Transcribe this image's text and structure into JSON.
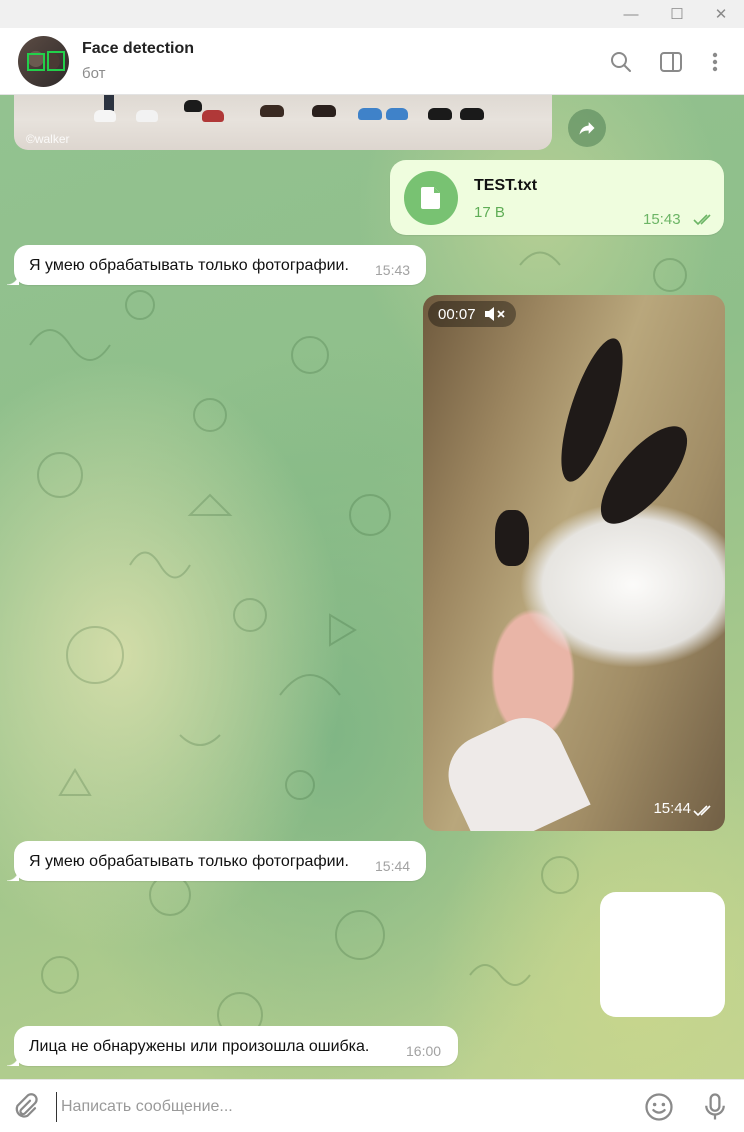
{
  "window": {
    "minimize": "—",
    "maximize": "☐",
    "close": "✕"
  },
  "header": {
    "title": "Face detection",
    "subtitle": "бот"
  },
  "messages": {
    "photo_watermark": "©walker",
    "file": {
      "name": "TEST.txt",
      "size": "17 B",
      "time": "15:43"
    },
    "in1": {
      "text": "Я умею обрабатывать только фотографии.",
      "time": "15:43"
    },
    "video": {
      "duration": "00:07",
      "time": "15:44"
    },
    "in2": {
      "text": "Я умею обрабатывать только фотографии.",
      "time": "15:44"
    },
    "in3": {
      "text": "Лица не обнаружены или произошла ошибка.",
      "time": "16:00"
    }
  },
  "composer": {
    "placeholder": "Написать сообщение..."
  },
  "colors": {
    "accent": "#78c272",
    "outgoing_bubble": "#effdde",
    "incoming_bubble": "#ffffff"
  },
  "icons": [
    "search-icon",
    "sidebar-toggle-icon",
    "more-icon",
    "share-icon",
    "file-icon",
    "muted-icon",
    "attach-icon",
    "emoji-icon",
    "microphone-icon"
  ]
}
